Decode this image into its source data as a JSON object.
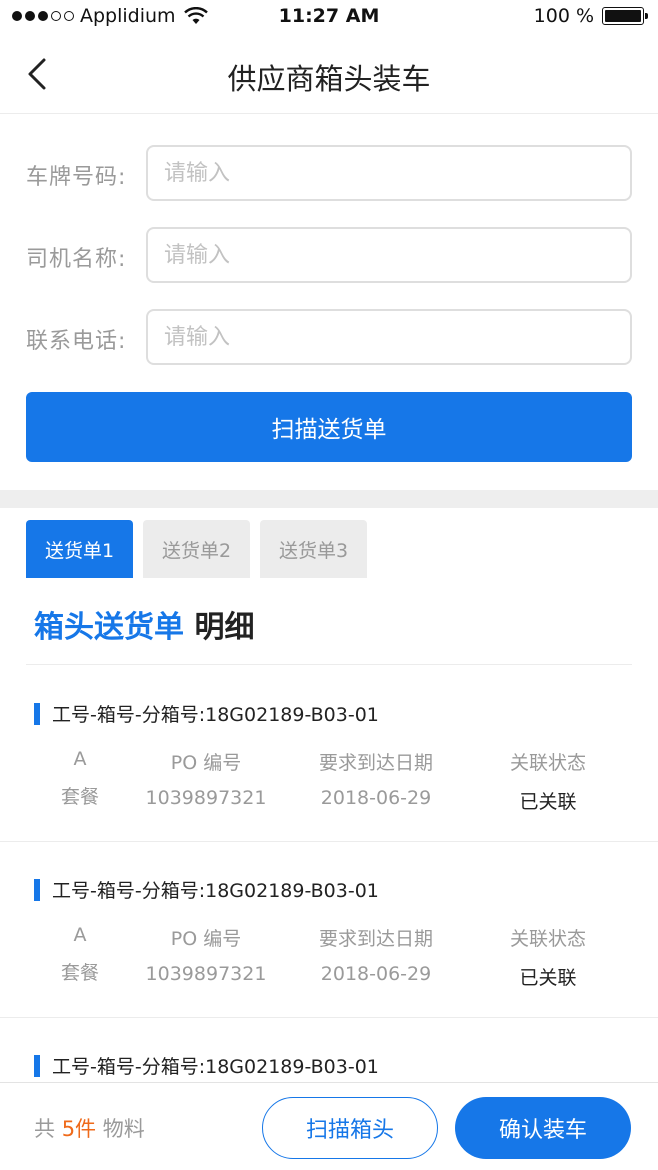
{
  "status_bar": {
    "carrier": "Applidium",
    "time": "11:27 AM",
    "battery": "100 %",
    "signal_dots_filled": 3,
    "signal_dots_total": 5,
    "battery_level": 1.0
  },
  "nav": {
    "title": "供应商箱头装车"
  },
  "form": {
    "fields": [
      {
        "label": "车牌号码:",
        "placeholder": "请输入",
        "value": ""
      },
      {
        "label": "司机名称:",
        "placeholder": "请输入",
        "value": ""
      },
      {
        "label": "联系电话:",
        "placeholder": "请输入",
        "value": ""
      }
    ],
    "scan_button": "扫描送货单"
  },
  "tabs": [
    {
      "label": "送货单1",
      "active": true
    },
    {
      "label": "送货单2",
      "active": false
    },
    {
      "label": "送货单3",
      "active": false
    }
  ],
  "section": {
    "title_highlight": "箱头送货单",
    "title_rest": "明细"
  },
  "cards": [
    {
      "header": "工号-箱号-分箱号:18G02189-B03-01",
      "col_a_key": "A",
      "col_a_value": "套餐",
      "col_b_key": "PO 编号",
      "col_b_value": "1039897321",
      "col_c_key": "要求到达日期",
      "col_c_value": "2018-06-29",
      "col_d_key": "关联状态",
      "col_d_value": "已关联"
    },
    {
      "header": "工号-箱号-分箱号:18G02189-B03-01",
      "col_a_key": "A",
      "col_a_value": "套餐",
      "col_b_key": "PO 编号",
      "col_b_value": "1039897321",
      "col_c_key": "要求到达日期",
      "col_c_value": "2018-06-29",
      "col_d_key": "关联状态",
      "col_d_value": "已关联"
    },
    {
      "header": "工号-箱号-分箱号:18G02189-B03-01"
    }
  ],
  "bottom": {
    "total_prefix": "共",
    "total_count": "5件",
    "total_suffix": "物料",
    "scan_box_button": "扫描箱头",
    "confirm_button": "确认装车"
  },
  "colors": {
    "accent": "#1677e8",
    "count_highlight": "#ef6a1a"
  }
}
